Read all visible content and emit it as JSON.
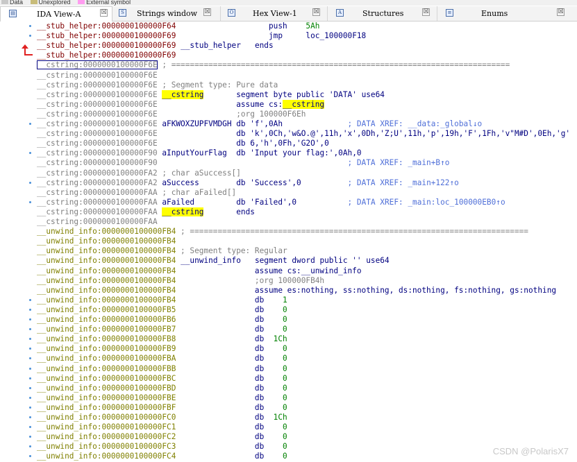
{
  "legend": [
    {
      "label": "Data",
      "color": "#c8c8c8"
    },
    {
      "label": "Unexplored",
      "color": "#c8bc7a"
    },
    {
      "label": "External symbol",
      "color": "#ff9cf0"
    }
  ],
  "tabs": [
    {
      "label": "IDA View-A",
      "icon": "ida-view-icon",
      "active": true
    },
    {
      "label": "Strings window",
      "icon": "strings-icon",
      "active": false
    },
    {
      "label": "Hex View-1",
      "icon": "hex-view-icon",
      "active": false
    },
    {
      "label": "Structures",
      "icon": "structures-icon",
      "active": false
    },
    {
      "label": "Enums",
      "icon": "enums-icon",
      "active": false
    }
  ],
  "close_glyph": "☒",
  "watermark": "CSDN @PolarisX7",
  "lines": [
    {
      "addr": "__stub_helper:0000000100000F64",
      "seg": "stub",
      "dot": true,
      "c": [
        {
          "t": "                    "
        },
        {
          "t": "push    ",
          "k": "n"
        },
        {
          "t": "5Ah",
          "k": "num"
        }
      ]
    },
    {
      "addr": "__stub_helper:0000000100000F69",
      "seg": "stub",
      "dot": true,
      "c": [
        {
          "t": "                    "
        },
        {
          "t": "jmp     ",
          "k": "n"
        },
        {
          "t": "loc_100000F18",
          "k": "n"
        }
      ]
    },
    {
      "addr": "__stub_helper:0000000100000F69",
      "seg": "stub",
      "c": [
        {
          "t": " "
        },
        {
          "t": "__stub_helper",
          "k": "n"
        },
        {
          "t": "   "
        },
        {
          "t": "ends",
          "k": "n"
        }
      ]
    },
    {
      "addr": "__stub_helper:0000000100000F69",
      "seg": "stub",
      "c": []
    },
    {
      "addr": "__cstring:0000000100000F6E",
      "seg": "cstr",
      "selected": true,
      "c": [
        {
          "t": " ; =========================================================================",
          "k": "cm"
        }
      ]
    },
    {
      "addr": "__cstring:0000000100000F6E",
      "seg": "cstr",
      "c": []
    },
    {
      "addr": "__cstring:0000000100000F6E",
      "seg": "cstr",
      "c": [
        {
          "t": " ; Segment type: Pure data",
          "k": "cm"
        }
      ]
    },
    {
      "addr": "__cstring:0000000100000F6E",
      "seg": "cstr",
      "c": [
        {
          "t": " "
        },
        {
          "t": "__cstring",
          "k": "nh"
        },
        {
          "t": "       "
        },
        {
          "t": "segment byte public 'DATA' use64",
          "k": "n"
        }
      ]
    },
    {
      "addr": "__cstring:0000000100000F6E",
      "seg": "cstr",
      "c": [
        {
          "t": "                 "
        },
        {
          "t": "assume cs:",
          "k": "n"
        },
        {
          "t": "__cstring",
          "k": "nh"
        }
      ]
    },
    {
      "addr": "__cstring:0000000100000F6E",
      "seg": "cstr",
      "c": [
        {
          "t": "                 "
        },
        {
          "t": ";org 100000F6Eh",
          "k": "cm"
        }
      ]
    },
    {
      "addr": "__cstring:0000000100000F6E",
      "seg": "cstr",
      "dot": true,
      "c": [
        {
          "t": " "
        },
        {
          "t": "aFKWOXZUPFVMDGH",
          "k": "n"
        },
        {
          "t": " "
        },
        {
          "t": "db 'f',0Ah",
          "k": "n"
        },
        {
          "t": "              "
        },
        {
          "t": "; DATA XREF: __data:_global↓o",
          "k": "xr"
        }
      ]
    },
    {
      "addr": "__cstring:0000000100000F6E",
      "seg": "cstr",
      "c": [
        {
          "t": "                 "
        },
        {
          "t": "db 'k',0Ch,'w&O.@',11h,'x',0Dh,'Z;U',11h,'p',19h,'F',1Fh,'v\"M#D',0Eh,'g'",
          "k": "n"
        }
      ]
    },
    {
      "addr": "__cstring:0000000100000F6E",
      "seg": "cstr",
      "c": [
        {
          "t": "                 "
        },
        {
          "t": "db 6,'h',0Fh,'G2O',0",
          "k": "n"
        }
      ]
    },
    {
      "addr": "__cstring:0000000100000F90",
      "seg": "cstr",
      "dot": true,
      "c": [
        {
          "t": " "
        },
        {
          "t": "aInputYourFlag",
          "k": "n"
        },
        {
          "t": "  "
        },
        {
          "t": "db 'Input your flag:',0Ah,0",
          "k": "n"
        }
      ]
    },
    {
      "addr": "__cstring:0000000100000F90",
      "seg": "cstr",
      "c": [
        {
          "t": "                                         "
        },
        {
          "t": "; DATA XREF: _main+B↑o",
          "k": "xr"
        }
      ]
    },
    {
      "addr": "__cstring:0000000100000FA2",
      "seg": "cstr",
      "c": [
        {
          "t": " ; char aSuccess[]",
          "k": "cm"
        }
      ]
    },
    {
      "addr": "__cstring:0000000100000FA2",
      "seg": "cstr",
      "dot": true,
      "c": [
        {
          "t": " "
        },
        {
          "t": "aSuccess",
          "k": "n"
        },
        {
          "t": "        "
        },
        {
          "t": "db 'Success',0",
          "k": "n"
        },
        {
          "t": "          "
        },
        {
          "t": "; DATA XREF: _main+122↑o",
          "k": "xr"
        }
      ]
    },
    {
      "addr": "__cstring:0000000100000FAA",
      "seg": "cstr",
      "c": [
        {
          "t": " ; char aFailed[]",
          "k": "cm"
        }
      ]
    },
    {
      "addr": "__cstring:0000000100000FAA",
      "seg": "cstr",
      "dot": true,
      "c": [
        {
          "t": " "
        },
        {
          "t": "aFailed",
          "k": "n"
        },
        {
          "t": "         "
        },
        {
          "t": "db 'Failed',0",
          "k": "n"
        },
        {
          "t": "           "
        },
        {
          "t": "; DATA XREF: _main:loc_100000EB0↑o",
          "k": "xr"
        }
      ]
    },
    {
      "addr": "__cstring:0000000100000FAA",
      "seg": "cstr",
      "c": [
        {
          "t": " "
        },
        {
          "t": "__cstring",
          "k": "nh"
        },
        {
          "t": "       "
        },
        {
          "t": "ends",
          "k": "n"
        }
      ]
    },
    {
      "addr": "__cstring:0000000100000FAA",
      "seg": "cstr",
      "c": []
    },
    {
      "addr": "__unwind_info:0000000100000FB4",
      "seg": "unw",
      "c": [
        {
          "t": " ; =========================================================================",
          "k": "cm"
        }
      ]
    },
    {
      "addr": "__unwind_info:0000000100000FB4",
      "seg": "unw",
      "c": []
    },
    {
      "addr": "__unwind_info:0000000100000FB4",
      "seg": "unw",
      "c": [
        {
          "t": " ; Segment type: Regular",
          "k": "cm"
        }
      ]
    },
    {
      "addr": "__unwind_info:0000000100000FB4",
      "seg": "unw",
      "c": [
        {
          "t": " "
        },
        {
          "t": "__unwind_info",
          "k": "n"
        },
        {
          "t": "   "
        },
        {
          "t": "segment dword public '' use64",
          "k": "n"
        }
      ]
    },
    {
      "addr": "__unwind_info:0000000100000FB4",
      "seg": "unw",
      "c": [
        {
          "t": "                 "
        },
        {
          "t": "assume cs:__unwind_info",
          "k": "n"
        }
      ]
    },
    {
      "addr": "__unwind_info:0000000100000FB4",
      "seg": "unw",
      "c": [
        {
          "t": "                 "
        },
        {
          "t": ";org 100000FB4h",
          "k": "cm"
        }
      ]
    },
    {
      "addr": "__unwind_info:0000000100000FB4",
      "seg": "unw",
      "c": [
        {
          "t": "                 "
        },
        {
          "t": "assume es:nothing, ss:nothing, ds:nothing, fs:nothing, gs:nothing",
          "k": "n"
        }
      ]
    },
    {
      "addr": "__unwind_info:0000000100000FB4",
      "seg": "unw",
      "dot": true,
      "c": [
        {
          "t": "                 "
        },
        {
          "t": "db    ",
          "k": "n"
        },
        {
          "t": "1",
          "k": "num"
        }
      ]
    },
    {
      "addr": "__unwind_info:0000000100000FB5",
      "seg": "unw",
      "dot": true,
      "c": [
        {
          "t": "                 "
        },
        {
          "t": "db    ",
          "k": "n"
        },
        {
          "t": "0",
          "k": "num"
        }
      ]
    },
    {
      "addr": "__unwind_info:0000000100000FB6",
      "seg": "unw",
      "dot": true,
      "c": [
        {
          "t": "                 "
        },
        {
          "t": "db    ",
          "k": "n"
        },
        {
          "t": "0",
          "k": "num"
        }
      ]
    },
    {
      "addr": "__unwind_info:0000000100000FB7",
      "seg": "unw",
      "dot": true,
      "c": [
        {
          "t": "                 "
        },
        {
          "t": "db    ",
          "k": "n"
        },
        {
          "t": "0",
          "k": "num"
        }
      ]
    },
    {
      "addr": "__unwind_info:0000000100000FB8",
      "seg": "unw",
      "dot": true,
      "c": [
        {
          "t": "                 "
        },
        {
          "t": "db  ",
          "k": "n"
        },
        {
          "t": "1Ch",
          "k": "num"
        }
      ]
    },
    {
      "addr": "__unwind_info:0000000100000FB9",
      "seg": "unw",
      "dot": true,
      "c": [
        {
          "t": "                 "
        },
        {
          "t": "db    ",
          "k": "n"
        },
        {
          "t": "0",
          "k": "num"
        }
      ]
    },
    {
      "addr": "__unwind_info:0000000100000FBA",
      "seg": "unw",
      "dot": true,
      "c": [
        {
          "t": "                 "
        },
        {
          "t": "db    ",
          "k": "n"
        },
        {
          "t": "0",
          "k": "num"
        }
      ]
    },
    {
      "addr": "__unwind_info:0000000100000FBB",
      "seg": "unw",
      "dot": true,
      "c": [
        {
          "t": "                 "
        },
        {
          "t": "db    ",
          "k": "n"
        },
        {
          "t": "0",
          "k": "num"
        }
      ]
    },
    {
      "addr": "__unwind_info:0000000100000FBC",
      "seg": "unw",
      "dot": true,
      "c": [
        {
          "t": "                 "
        },
        {
          "t": "db    ",
          "k": "n"
        },
        {
          "t": "0",
          "k": "num"
        }
      ]
    },
    {
      "addr": "__unwind_info:0000000100000FBD",
      "seg": "unw",
      "dot": true,
      "c": [
        {
          "t": "                 "
        },
        {
          "t": "db    ",
          "k": "n"
        },
        {
          "t": "0",
          "k": "num"
        }
      ]
    },
    {
      "addr": "__unwind_info:0000000100000FBE",
      "seg": "unw",
      "dot": true,
      "c": [
        {
          "t": "                 "
        },
        {
          "t": "db    ",
          "k": "n"
        },
        {
          "t": "0",
          "k": "num"
        }
      ]
    },
    {
      "addr": "__unwind_info:0000000100000FBF",
      "seg": "unw",
      "dot": true,
      "c": [
        {
          "t": "                 "
        },
        {
          "t": "db    ",
          "k": "n"
        },
        {
          "t": "0",
          "k": "num"
        }
      ]
    },
    {
      "addr": "__unwind_info:0000000100000FC0",
      "seg": "unw",
      "dot": true,
      "c": [
        {
          "t": "                 "
        },
        {
          "t": "db  ",
          "k": "n"
        },
        {
          "t": "1Ch",
          "k": "num"
        }
      ]
    },
    {
      "addr": "__unwind_info:0000000100000FC1",
      "seg": "unw",
      "dot": true,
      "c": [
        {
          "t": "                 "
        },
        {
          "t": "db    ",
          "k": "n"
        },
        {
          "t": "0",
          "k": "num"
        }
      ]
    },
    {
      "addr": "__unwind_info:0000000100000FC2",
      "seg": "unw",
      "dot": true,
      "c": [
        {
          "t": "                 "
        },
        {
          "t": "db    ",
          "k": "n"
        },
        {
          "t": "0",
          "k": "num"
        }
      ]
    },
    {
      "addr": "__unwind_info:0000000100000FC3",
      "seg": "unw",
      "dot": true,
      "c": [
        {
          "t": "                 "
        },
        {
          "t": "db    ",
          "k": "n"
        },
        {
          "t": "0",
          "k": "num"
        }
      ]
    },
    {
      "addr": "__unwind_info:0000000100000FC4",
      "seg": "unw",
      "dot": true,
      "c": [
        {
          "t": "                 "
        },
        {
          "t": "db    ",
          "k": "n"
        },
        {
          "t": "0",
          "k": "num"
        }
      ]
    }
  ]
}
